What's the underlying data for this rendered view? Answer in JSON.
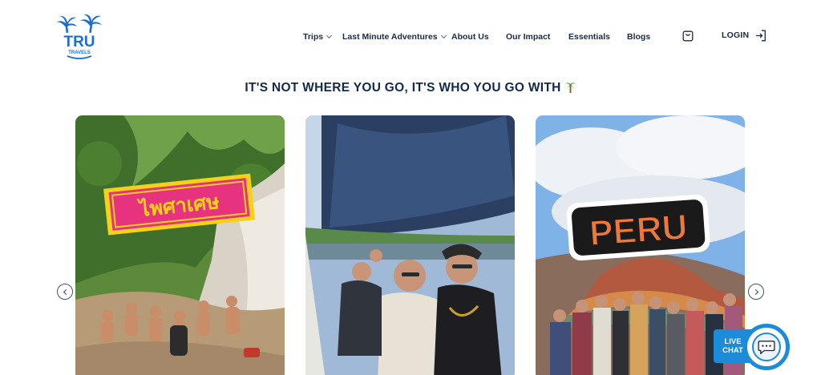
{
  "brand": {
    "name": "TRU",
    "tagline": "TRAVELS",
    "color": "#1c6fd1"
  },
  "nav": {
    "items": [
      {
        "label": "Trips",
        "has_dropdown": true
      },
      {
        "label": "Last Minute Adventures",
        "has_dropdown": true
      },
      {
        "label": "About Us",
        "has_dropdown": false
      },
      {
        "label": "Our Impact",
        "has_dropdown": false
      },
      {
        "label": "Essentials",
        "has_dropdown": false
      },
      {
        "label": "Blogs",
        "has_dropdown": false
      }
    ],
    "cart_icon": "shopping-bag-icon",
    "login_label": "LOGIN",
    "login_icon": "login-icon"
  },
  "hero": {
    "headline": "IT'S NOT WHERE YOU GO, IT'S WHO YOU GO WITH",
    "headline_icon": "palm-tree-icon"
  },
  "carousel": {
    "prev_icon": "chevron-left-icon",
    "next_icon": "chevron-right-icon",
    "cards": [
      {
        "sticker": "ไพศาเศษ",
        "scene": "waterfall-group-photo"
      },
      {
        "sticker": "",
        "scene": "boat-selfie"
      },
      {
        "sticker": "PERU",
        "scene": "rainbow-mountain-group-photo"
      }
    ]
  },
  "chat": {
    "label_line1": "LIVE",
    "label_line2": "CHAT",
    "icon": "chat-bubble-icon",
    "accent": "#1c8bd8"
  }
}
